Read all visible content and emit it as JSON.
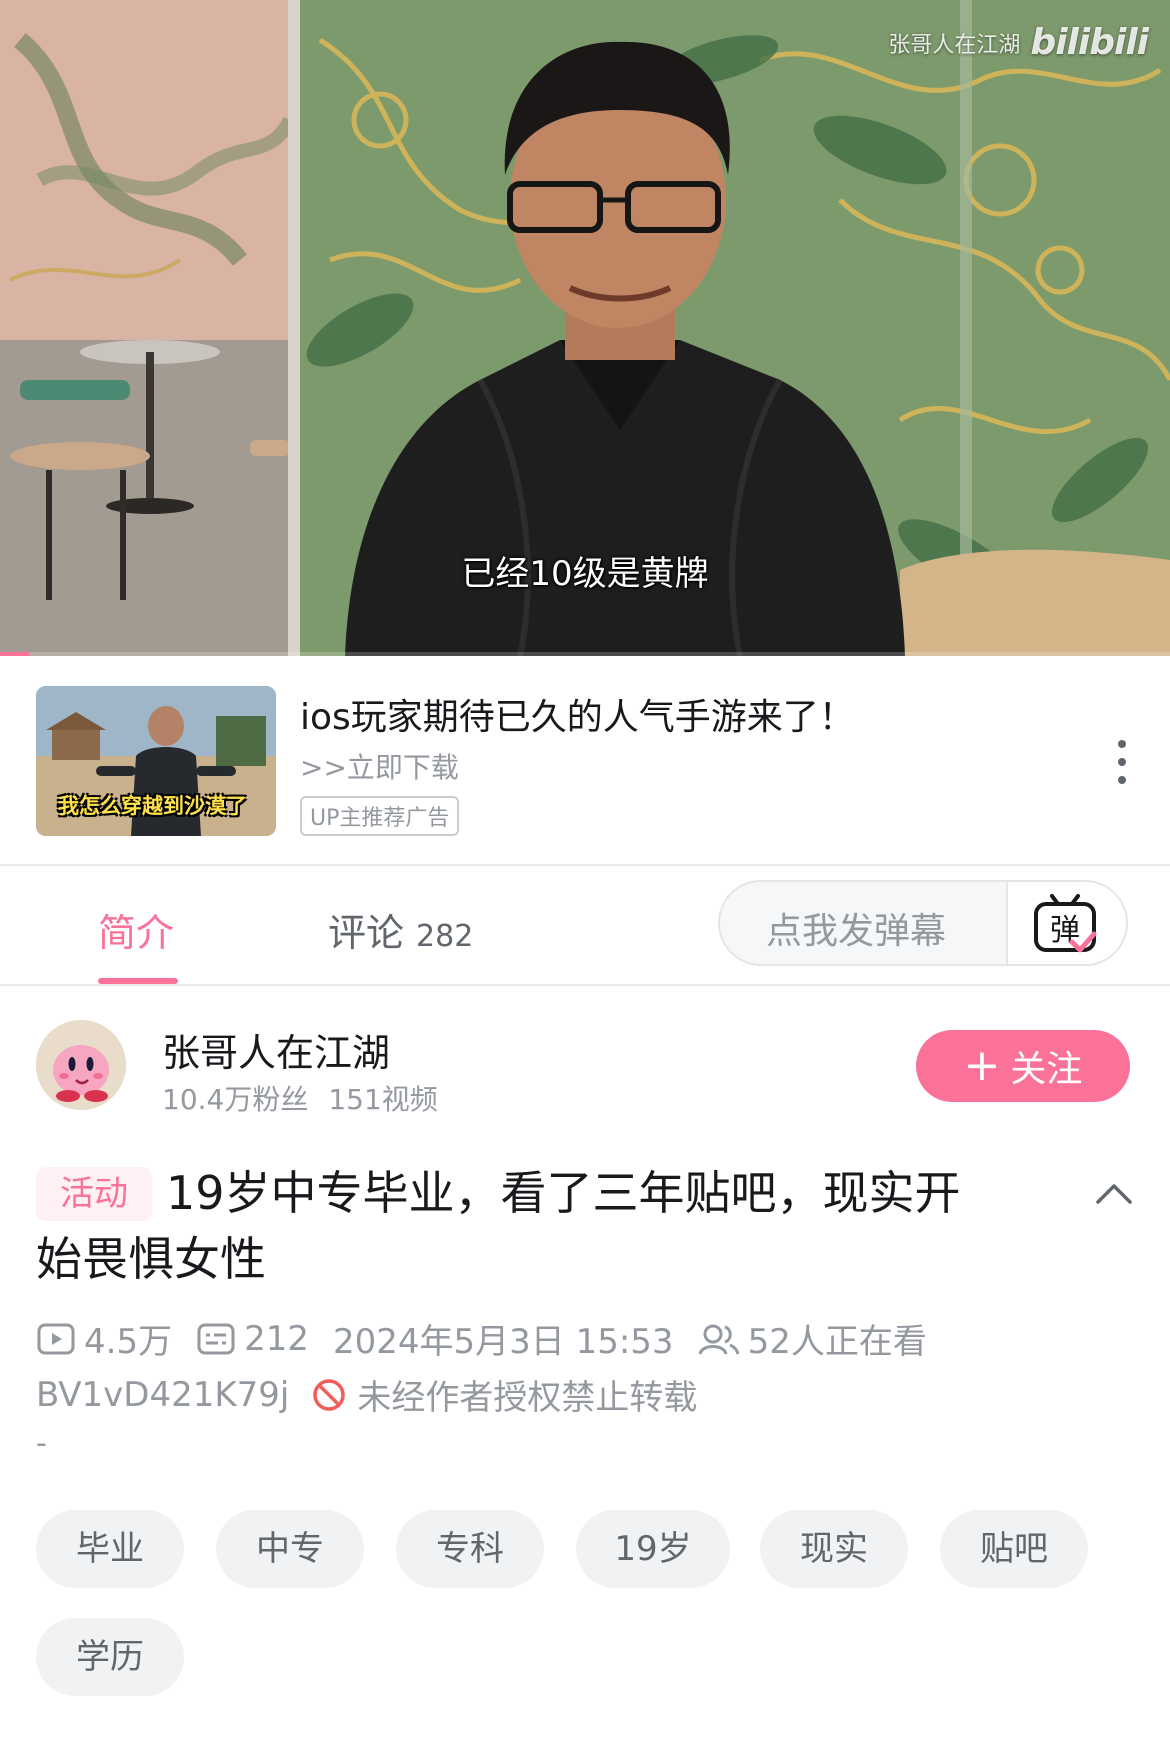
{
  "player": {
    "watermark_text": "张哥人在江湖",
    "watermark_logo": "bilibili",
    "subtitle": "已经10级是黄牌",
    "progress_fraction": 0.025,
    "accent": "#fb7299"
  },
  "ad": {
    "thumb_caption": "我怎么穿越到沙漠了",
    "title": "ios玩家期待已久的人气手游来了！",
    "link": ">>立即下载",
    "badge": "UP主推荐广告",
    "more_icon": "more-vertical-icon"
  },
  "tabs": {
    "intro": "简介",
    "comments": "评论",
    "comments_count": "282",
    "danmaku_placeholder": "点我发弹幕",
    "danmaku_icon": "弹",
    "active": "intro"
  },
  "uploader": {
    "name": "张哥人在江湖",
    "followers": "10.4万粉丝",
    "videos": "151视频",
    "follow_label": "关注",
    "follow_plus": "+"
  },
  "video": {
    "activity_tag": "活动",
    "title_line1": "19岁中专毕业，看了三年贴吧，现实开",
    "title_line2": "始畏惧女性",
    "views": "4.5万",
    "danmaku_count": "212",
    "date": "2024年5月3日 15:53",
    "watching": "52人正在看",
    "bvid": "BV1vD421K79j",
    "copyright": "未经作者授权禁止转载",
    "description": "-",
    "tags": [
      "毕业",
      "中专",
      "专科",
      "19岁",
      "现实",
      "贴吧",
      "学历"
    ]
  }
}
